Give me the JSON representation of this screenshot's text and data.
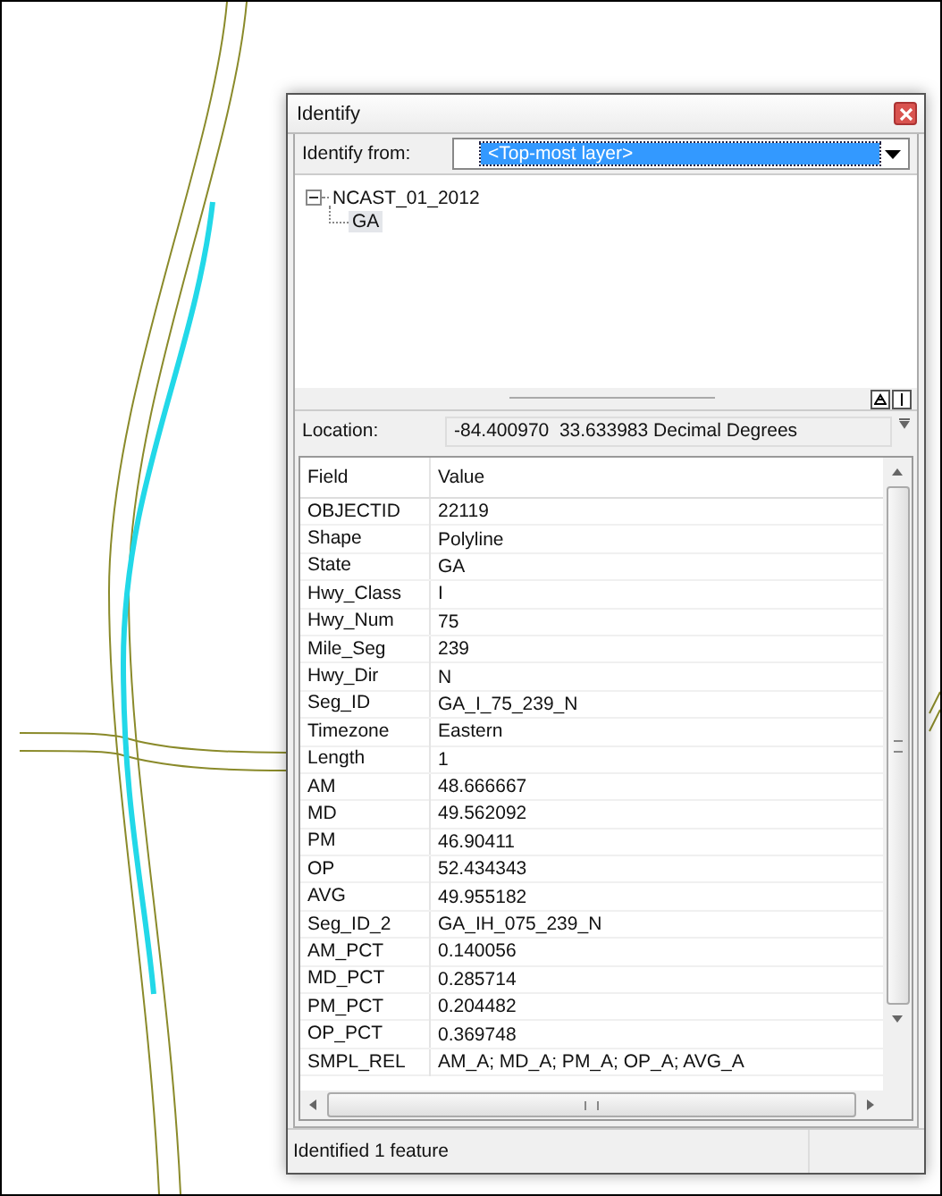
{
  "window": {
    "title": "Identify"
  },
  "identify_from": {
    "label": "Identify from:",
    "value": "<Top-most layer>"
  },
  "tree": [
    {
      "label": "NCAST_01_2012",
      "expanded": true,
      "selected": false,
      "children": [
        {
          "label": "GA",
          "selected": true
        }
      ]
    }
  ],
  "location": {
    "label": "Location:",
    "value": "-84.400970  33.633983 Decimal Degrees"
  },
  "table": {
    "columns": [
      "Field",
      "Value"
    ],
    "rows": [
      [
        "OBJECTID",
        "22119"
      ],
      [
        "Shape",
        "Polyline"
      ],
      [
        "State",
        "GA"
      ],
      [
        "Hwy_Class",
        "I"
      ],
      [
        "Hwy_Num",
        "75"
      ],
      [
        "Mile_Seg",
        "239"
      ],
      [
        "Hwy_Dir",
        "N"
      ],
      [
        "Seg_ID",
        "GA_I_75_239_N"
      ],
      [
        "Timezone",
        "Eastern"
      ],
      [
        "Length",
        "1"
      ],
      [
        "AM",
        "48.666667"
      ],
      [
        "MD",
        "49.562092"
      ],
      [
        "PM",
        "46.90411"
      ],
      [
        "OP",
        "52.434343"
      ],
      [
        "AVG",
        "49.955182"
      ],
      [
        "Seg_ID_2",
        "GA_IH_075_239_N"
      ],
      [
        "AM_PCT",
        "0.140056"
      ],
      [
        "MD_PCT",
        "0.285714"
      ],
      [
        "PM_PCT",
        "0.204482"
      ],
      [
        "OP_PCT",
        "0.369748"
      ],
      [
        "SMPL_REL",
        "AM_A; MD_A; PM_A; OP_A; AVG_A"
      ]
    ]
  },
  "status_bar": "Identified 1 feature"
}
